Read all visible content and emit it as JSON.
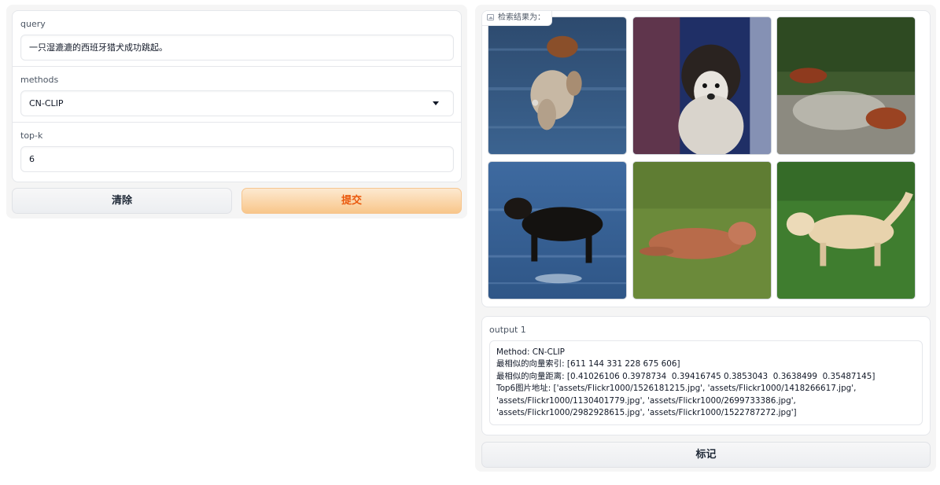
{
  "inputs": {
    "query_label": "query",
    "query_value": "一只湿漉漉的西班牙猎犬成功跳起。",
    "methods_label": "methods",
    "methods_value": "CN-CLIP",
    "topk_label": "top-k",
    "topk_value": "6"
  },
  "buttons": {
    "clear": "清除",
    "submit": "提交",
    "flag": "标记"
  },
  "gallery": {
    "label": "检索结果为：",
    "icon": "image-icon",
    "images": [
      "spaniel-jumping-in-water",
      "spaniel-shaking-water",
      "red-dogs-running-in-water",
      "black-dog-in-water",
      "tan-dog-running-on-grass",
      "golden-retriever-running-on-grass"
    ]
  },
  "output": {
    "label": "output 1",
    "text": "Method: CN-CLIP\n最相似的向量索引: [611 144 331 228 675 606]\n最相似的向量距离: [0.41026106 0.3978734  0.39416745 0.3853043  0.3638499  0.35487145]\nTop6图片地址: ['assets/Flickr1000/1526181215.jpg', 'assets/Flickr1000/1418266617.jpg', 'assets/Flickr1000/1130401779.jpg', 'assets/Flickr1000/2699733386.jpg', 'assets/Flickr1000/2982928615.jpg', 'assets/Flickr1000/1522787272.jpg']"
  }
}
